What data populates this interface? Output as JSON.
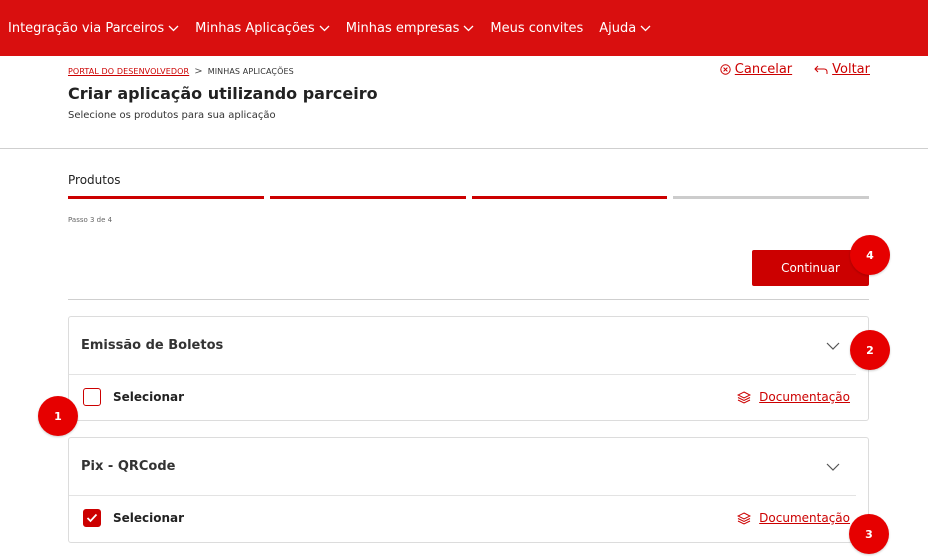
{
  "nav": {
    "items": [
      {
        "label": "Integração via Parceiros",
        "has_dropdown": true
      },
      {
        "label": "Minhas Aplicações",
        "has_dropdown": true
      },
      {
        "label": "Minhas empresas",
        "has_dropdown": true
      },
      {
        "label": "Meus convites",
        "has_dropdown": false
      },
      {
        "label": "Ajuda",
        "has_dropdown": true
      }
    ],
    "background_color": "#d90f0f"
  },
  "breadcrumb": {
    "link": "PORTAL DO DESENVOLVEDOR",
    "current": "MINHAS APLICAÇÕES"
  },
  "header": {
    "title": "Criar aplicação utilizando parceiro",
    "subtitle": "Selecione os produtos para sua aplicação",
    "cancel_label": "Cancelar",
    "back_label": "Voltar"
  },
  "stepper": {
    "label": "Produtos",
    "step_text": "Passo 3 de 4",
    "current_step": 3,
    "total_steps": 4
  },
  "continue_button": {
    "label": "Continuar"
  },
  "products": [
    {
      "title": "Emissão de Boletos",
      "select_label": "Selecionar",
      "selected": false,
      "doc_label": "Documentação"
    },
    {
      "title": "Pix - QRCode",
      "select_label": "Selecionar",
      "selected": true,
      "doc_label": "Documentação"
    }
  ],
  "badges": {
    "b1": "1",
    "b2": "2",
    "b3": "3",
    "b4": "4"
  },
  "colors": {
    "accent": "#cc0000",
    "badge": "#e60000"
  }
}
